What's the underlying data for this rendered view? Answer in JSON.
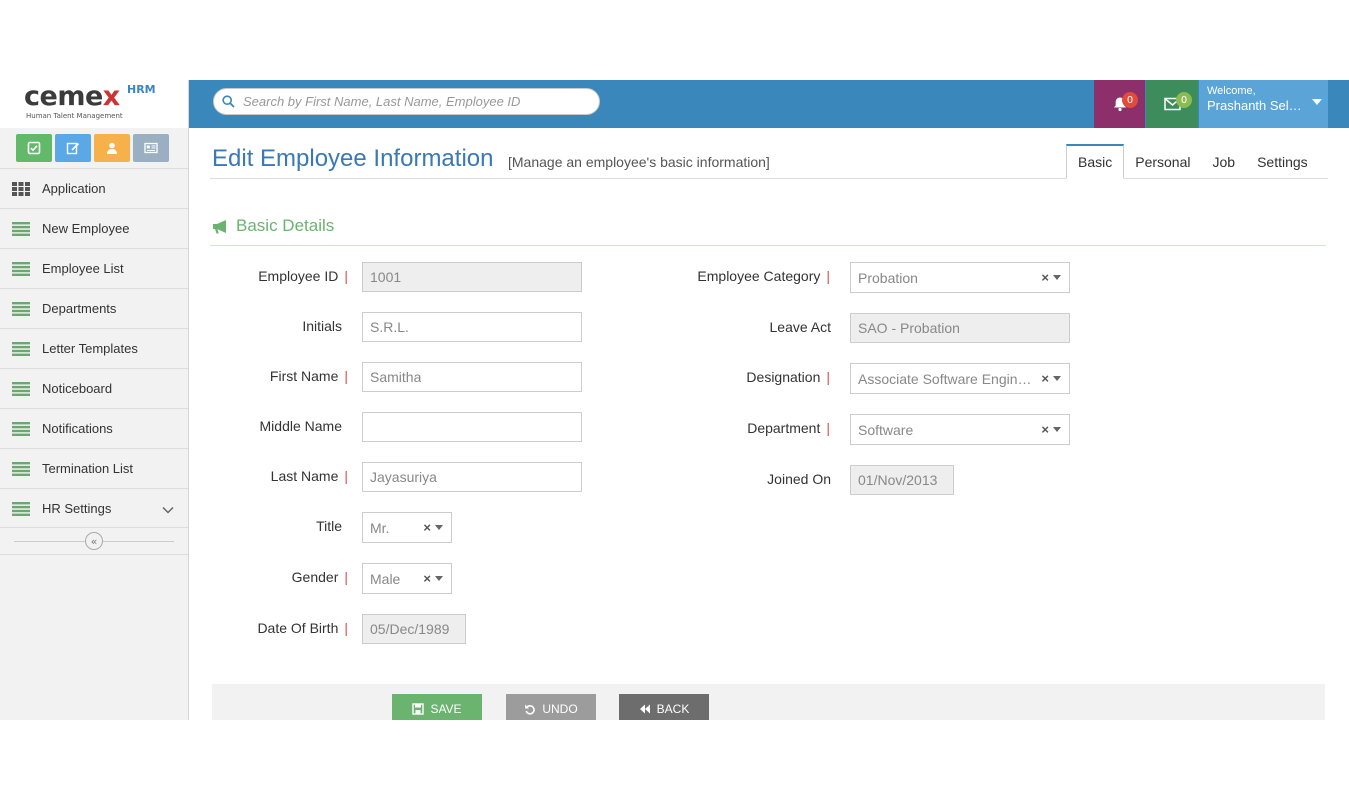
{
  "brand": {
    "logo_main": "ceme",
    "logo_x": "x",
    "logo_hrm": "HRM",
    "logo_sub": "Human Talent Management"
  },
  "quick_buttons": [
    {
      "icon": "check-square-icon",
      "color": "#62b96a"
    },
    {
      "icon": "edit-icon",
      "color": "#5aa9e6"
    },
    {
      "icon": "user-icon",
      "color": "#f6b14a"
    },
    {
      "icon": "id-card-icon",
      "color": "#9ab0c2"
    }
  ],
  "sidebar": {
    "items": [
      {
        "label": "Application",
        "icon": "grid-icon"
      },
      {
        "label": "New Employee",
        "icon": "list-icon"
      },
      {
        "label": "Employee List",
        "icon": "list-icon"
      },
      {
        "label": "Departments",
        "icon": "list-icon"
      },
      {
        "label": "Letter Templates",
        "icon": "list-icon"
      },
      {
        "label": "Noticeboard",
        "icon": "list-icon"
      },
      {
        "label": "Notifications",
        "icon": "list-icon"
      },
      {
        "label": "Termination List",
        "icon": "list-icon"
      },
      {
        "label": "HR Settings",
        "icon": "list-icon"
      }
    ],
    "collapse_glyph": "«"
  },
  "topbar": {
    "search_placeholder": "Search by First Name, Last Name, Employee ID",
    "notifications_count": "0",
    "messages_count": "0",
    "welcome": "Welcome,",
    "user_name": "Prashanth Selvarajah",
    "colors": {
      "bar": "#3a87bc",
      "notifications": "#8c2f6a",
      "messages": "#3c8c5c",
      "user": "#5aa4d8"
    }
  },
  "page": {
    "title": "Edit Employee Information",
    "subtitle": "[Manage an employee's basic information]",
    "tabs": [
      "Basic",
      "Personal",
      "Job",
      "Settings"
    ],
    "active_tab": "Basic"
  },
  "section": {
    "title": "Basic Details"
  },
  "form": {
    "left": {
      "employee_id": {
        "label": "Employee ID",
        "value": "1001",
        "required": "|"
      },
      "initials": {
        "label": "Initials",
        "placeholder": "S.R.L."
      },
      "first_name": {
        "label": "First Name",
        "value": "Samitha",
        "required": "|"
      },
      "middle_name": {
        "label": "Middle Name",
        "value": ""
      },
      "last_name": {
        "label": "Last Name",
        "value": "Jayasuriya",
        "required": "|"
      },
      "title": {
        "label": "Title",
        "value": "Mr."
      },
      "gender": {
        "label": "Gender",
        "value": "Male",
        "required": "|"
      },
      "date_of_birth": {
        "label": "Date Of Birth",
        "value": "05/Dec/1989",
        "required": "|"
      }
    },
    "right": {
      "employee_category": {
        "label": "Employee Category",
        "value": "Probation",
        "required": "|"
      },
      "leave_act": {
        "label": "Leave Act",
        "value": "SAO - Probation"
      },
      "designation": {
        "label": "Designation",
        "value": "Associate Software Engineer",
        "required": "|"
      },
      "department": {
        "label": "Department",
        "value": "Software",
        "required": "|"
      },
      "joined_on": {
        "label": "Joined On",
        "value": "01/Nov/2013"
      }
    },
    "select_clear": "×"
  },
  "actions": {
    "save": "SAVE",
    "undo": "UNDO",
    "back": "BACK"
  }
}
